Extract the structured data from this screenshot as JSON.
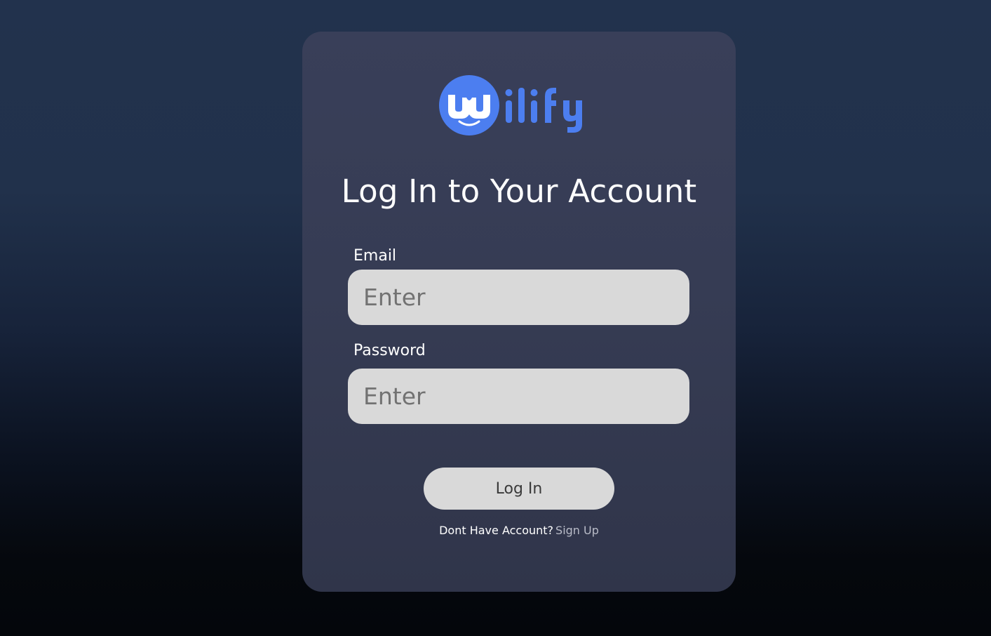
{
  "brand": {
    "logo_text": "Wilify",
    "logo_color": "#4c7ef0"
  },
  "login": {
    "title": "Log In to Your Account",
    "email_label": "Email",
    "email_placeholder": "Enter",
    "email_value": "",
    "password_label": "Password",
    "password_placeholder": "Enter",
    "password_value": "",
    "submit_label": "Log In",
    "signup_prompt": "Dont Have Account?",
    "signup_link": "Sign Up"
  },
  "colors": {
    "card_bg": "#393f59",
    "input_bg": "#d9d9d9",
    "button_bg": "#d9d9d9",
    "link_color": "#b9bcc8"
  }
}
